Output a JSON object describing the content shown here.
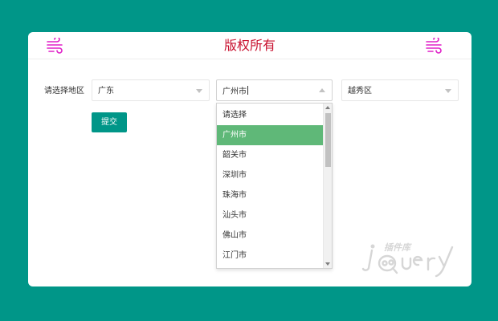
{
  "header": {
    "title": "版权所有",
    "left_icon": "wind-icon",
    "right_icon": "wind-icon",
    "title_color": "#c8102e",
    "icon_color": "#e020c8"
  },
  "form": {
    "label": "请选择地区",
    "province": {
      "value": "广东"
    },
    "city": {
      "value": "广州市",
      "open": true
    },
    "district": {
      "value": "越秀区"
    },
    "submit_label": "提交"
  },
  "city_options": [
    {
      "label": "请选择"
    },
    {
      "label": "广州市",
      "selected": true
    },
    {
      "label": "韶关市"
    },
    {
      "label": "深圳市"
    },
    {
      "label": "珠海市"
    },
    {
      "label": "汕头市"
    },
    {
      "label": "佛山市"
    },
    {
      "label": "江门市"
    }
  ],
  "colors": {
    "background": "#009688",
    "accent": "#009688",
    "selected_option": "#5fb878"
  },
  "watermark": {
    "text": "插件库",
    "brand": "jQuery"
  }
}
